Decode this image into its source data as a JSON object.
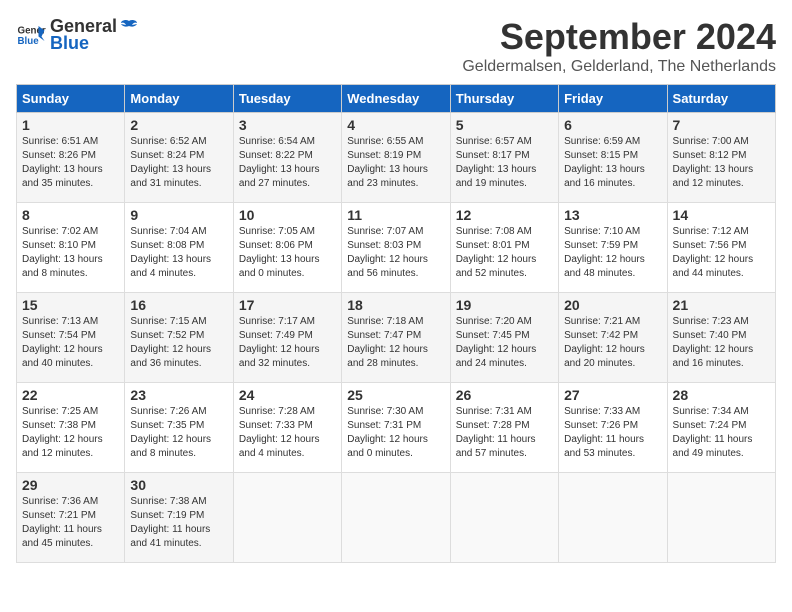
{
  "logo": {
    "general": "General",
    "blue": "Blue"
  },
  "title": {
    "month": "September 2024",
    "location": "Geldermalsen, Gelderland, The Netherlands"
  },
  "headers": [
    "Sunday",
    "Monday",
    "Tuesday",
    "Wednesday",
    "Thursday",
    "Friday",
    "Saturday"
  ],
  "weeks": [
    [
      {
        "day": "1",
        "sunrise": "6:51 AM",
        "sunset": "8:26 PM",
        "daylight": "13 hours and 35 minutes."
      },
      {
        "day": "2",
        "sunrise": "6:52 AM",
        "sunset": "8:24 PM",
        "daylight": "13 hours and 31 minutes."
      },
      {
        "day": "3",
        "sunrise": "6:54 AM",
        "sunset": "8:22 PM",
        "daylight": "13 hours and 27 minutes."
      },
      {
        "day": "4",
        "sunrise": "6:55 AM",
        "sunset": "8:19 PM",
        "daylight": "13 hours and 23 minutes."
      },
      {
        "day": "5",
        "sunrise": "6:57 AM",
        "sunset": "8:17 PM",
        "daylight": "13 hours and 19 minutes."
      },
      {
        "day": "6",
        "sunrise": "6:59 AM",
        "sunset": "8:15 PM",
        "daylight": "13 hours and 16 minutes."
      },
      {
        "day": "7",
        "sunrise": "7:00 AM",
        "sunset": "8:12 PM",
        "daylight": "13 hours and 12 minutes."
      }
    ],
    [
      {
        "day": "8",
        "sunrise": "7:02 AM",
        "sunset": "8:10 PM",
        "daylight": "13 hours and 8 minutes."
      },
      {
        "day": "9",
        "sunrise": "7:04 AM",
        "sunset": "8:08 PM",
        "daylight": "13 hours and 4 minutes."
      },
      {
        "day": "10",
        "sunrise": "7:05 AM",
        "sunset": "8:06 PM",
        "daylight": "13 hours and 0 minutes."
      },
      {
        "day": "11",
        "sunrise": "7:07 AM",
        "sunset": "8:03 PM",
        "daylight": "12 hours and 56 minutes."
      },
      {
        "day": "12",
        "sunrise": "7:08 AM",
        "sunset": "8:01 PM",
        "daylight": "12 hours and 52 minutes."
      },
      {
        "day": "13",
        "sunrise": "7:10 AM",
        "sunset": "7:59 PM",
        "daylight": "12 hours and 48 minutes."
      },
      {
        "day": "14",
        "sunrise": "7:12 AM",
        "sunset": "7:56 PM",
        "daylight": "12 hours and 44 minutes."
      }
    ],
    [
      {
        "day": "15",
        "sunrise": "7:13 AM",
        "sunset": "7:54 PM",
        "daylight": "12 hours and 40 minutes."
      },
      {
        "day": "16",
        "sunrise": "7:15 AM",
        "sunset": "7:52 PM",
        "daylight": "12 hours and 36 minutes."
      },
      {
        "day": "17",
        "sunrise": "7:17 AM",
        "sunset": "7:49 PM",
        "daylight": "12 hours and 32 minutes."
      },
      {
        "day": "18",
        "sunrise": "7:18 AM",
        "sunset": "7:47 PM",
        "daylight": "12 hours and 28 minutes."
      },
      {
        "day": "19",
        "sunrise": "7:20 AM",
        "sunset": "7:45 PM",
        "daylight": "12 hours and 24 minutes."
      },
      {
        "day": "20",
        "sunrise": "7:21 AM",
        "sunset": "7:42 PM",
        "daylight": "12 hours and 20 minutes."
      },
      {
        "day": "21",
        "sunrise": "7:23 AM",
        "sunset": "7:40 PM",
        "daylight": "12 hours and 16 minutes."
      }
    ],
    [
      {
        "day": "22",
        "sunrise": "7:25 AM",
        "sunset": "7:38 PM",
        "daylight": "12 hours and 12 minutes."
      },
      {
        "day": "23",
        "sunrise": "7:26 AM",
        "sunset": "7:35 PM",
        "daylight": "12 hours and 8 minutes."
      },
      {
        "day": "24",
        "sunrise": "7:28 AM",
        "sunset": "7:33 PM",
        "daylight": "12 hours and 4 minutes."
      },
      {
        "day": "25",
        "sunrise": "7:30 AM",
        "sunset": "7:31 PM",
        "daylight": "12 hours and 0 minutes."
      },
      {
        "day": "26",
        "sunrise": "7:31 AM",
        "sunset": "7:28 PM",
        "daylight": "11 hours and 57 minutes."
      },
      {
        "day": "27",
        "sunrise": "7:33 AM",
        "sunset": "7:26 PM",
        "daylight": "11 hours and 53 minutes."
      },
      {
        "day": "28",
        "sunrise": "7:34 AM",
        "sunset": "7:24 PM",
        "daylight": "11 hours and 49 minutes."
      }
    ],
    [
      {
        "day": "29",
        "sunrise": "7:36 AM",
        "sunset": "7:21 PM",
        "daylight": "11 hours and 45 minutes."
      },
      {
        "day": "30",
        "sunrise": "7:38 AM",
        "sunset": "7:19 PM",
        "daylight": "11 hours and 41 minutes."
      },
      null,
      null,
      null,
      null,
      null
    ]
  ]
}
